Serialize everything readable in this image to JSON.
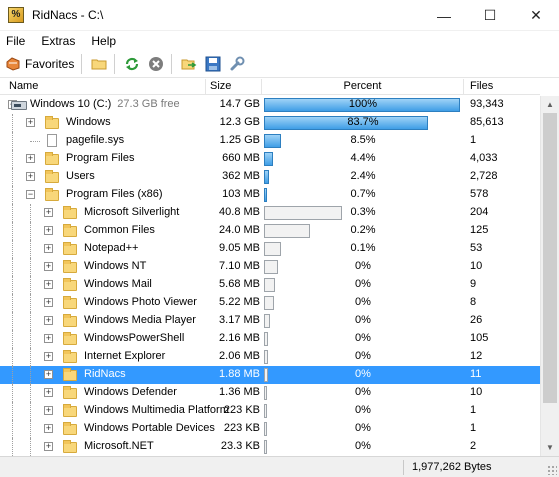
{
  "window": {
    "title": "RidNacs - C:\\",
    "app_icon_glyph": "%",
    "minimize": "—",
    "maximize": "☐",
    "close": "✕"
  },
  "menu": [
    "File",
    "Extras",
    "Help"
  ],
  "toolbar": {
    "favorites_label": "Favorites",
    "icons": [
      "star-icon",
      "folder-open-icon",
      "refresh-icon",
      "stop-icon",
      "export-icon",
      "save-icon",
      "wrench-icon"
    ]
  },
  "columns": {
    "name": "Name",
    "size": "Size",
    "percent": "Percent",
    "files": "Files"
  },
  "rows": [
    {
      "name": "Windows 10 (C:)",
      "extra": "27.3 GB free",
      "size": "14.7 GB",
      "percent": "100%",
      "pct": 100,
      "files": "93,343",
      "level": 0,
      "icon": "drive",
      "exp": "-"
    },
    {
      "name": "Windows",
      "size": "12.3 GB",
      "percent": "83.7%",
      "pct": 83.7,
      "files": "85,613",
      "level": 1,
      "icon": "folder",
      "exp": "+"
    },
    {
      "name": "pagefile.sys",
      "size": "1.25 GB",
      "percent": "8.5%",
      "pct": 8.5,
      "files": "1",
      "level": 1,
      "icon": "file",
      "exp": ""
    },
    {
      "name": "Program Files",
      "size": "660 MB",
      "percent": "4.4%",
      "pct": 4.4,
      "files": "4,033",
      "level": 1,
      "icon": "folder",
      "exp": "+"
    },
    {
      "name": "Users",
      "size": "362 MB",
      "percent": "2.4%",
      "pct": 2.4,
      "files": "2,728",
      "level": 1,
      "icon": "folder",
      "exp": "+"
    },
    {
      "name": "Program Files (x86)",
      "size": "103 MB",
      "percent": "0.7%",
      "pct": 0.7,
      "files": "578",
      "level": 1,
      "icon": "folder",
      "exp": "-"
    },
    {
      "name": "Microsoft Silverlight",
      "size": "40.8 MB",
      "percent": "0.3%",
      "pct": 39.6,
      "files": "204",
      "level": 2,
      "icon": "folder",
      "exp": "+",
      "gray": true
    },
    {
      "name": "Common Files",
      "size": "24.0 MB",
      "percent": "0.2%",
      "pct": 23.3,
      "files": "125",
      "level": 2,
      "icon": "folder",
      "exp": "+",
      "gray": true
    },
    {
      "name": "Notepad++",
      "size": "9.05 MB",
      "percent": "0.1%",
      "pct": 8.8,
      "files": "53",
      "level": 2,
      "icon": "folder",
      "exp": "+",
      "gray": true
    },
    {
      "name": "Windows NT",
      "size": "7.10 MB",
      "percent": "0%",
      "pct": 6.9,
      "files": "10",
      "level": 2,
      "icon": "folder",
      "exp": "+",
      "gray": true
    },
    {
      "name": "Windows Mail",
      "size": "5.68 MB",
      "percent": "0%",
      "pct": 5.5,
      "files": "9",
      "level": 2,
      "icon": "folder",
      "exp": "+",
      "gray": true
    },
    {
      "name": "Windows Photo Viewer",
      "size": "5.22 MB",
      "percent": "0%",
      "pct": 5.1,
      "files": "8",
      "level": 2,
      "icon": "folder",
      "exp": "+",
      "gray": true
    },
    {
      "name": "Windows Media Player",
      "size": "3.17 MB",
      "percent": "0%",
      "pct": 3.1,
      "files": "26",
      "level": 2,
      "icon": "folder",
      "exp": "+",
      "gray": true
    },
    {
      "name": "WindowsPowerShell",
      "size": "2.16 MB",
      "percent": "0%",
      "pct": 2.1,
      "files": "105",
      "level": 2,
      "icon": "folder",
      "exp": "+",
      "gray": true
    },
    {
      "name": "Internet Explorer",
      "size": "2.06 MB",
      "percent": "0%",
      "pct": 2.0,
      "files": "12",
      "level": 2,
      "icon": "folder",
      "exp": "+",
      "gray": true
    },
    {
      "name": "RidNacs",
      "size": "1.88 MB",
      "percent": "0%",
      "pct": 1.8,
      "files": "11",
      "level": 2,
      "icon": "folder",
      "exp": "+",
      "gray": true,
      "selected": true
    },
    {
      "name": "Windows Defender",
      "size": "1.36 MB",
      "percent": "0%",
      "pct": 1.3,
      "files": "10",
      "level": 2,
      "icon": "folder",
      "exp": "+",
      "gray": true
    },
    {
      "name": "Windows Multimedia Platform",
      "size": "223 KB",
      "percent": "0%",
      "pct": 0.2,
      "files": "1",
      "level": 2,
      "icon": "folder",
      "exp": "+",
      "gray": true
    },
    {
      "name": "Windows Portable Devices",
      "size": "223 KB",
      "percent": "0%",
      "pct": 0.2,
      "files": "1",
      "level": 2,
      "icon": "folder",
      "exp": "+",
      "gray": true
    },
    {
      "name": "Microsoft.NET",
      "size": "23.3 KB",
      "percent": "0%",
      "pct": 0.1,
      "files": "2",
      "level": 2,
      "icon": "folder",
      "exp": "+",
      "gray": true
    }
  ],
  "status": {
    "total": "1,977,262 Bytes"
  },
  "colors": {
    "selection": "#3399ff",
    "bar_blue": "#3f9ee6"
  }
}
